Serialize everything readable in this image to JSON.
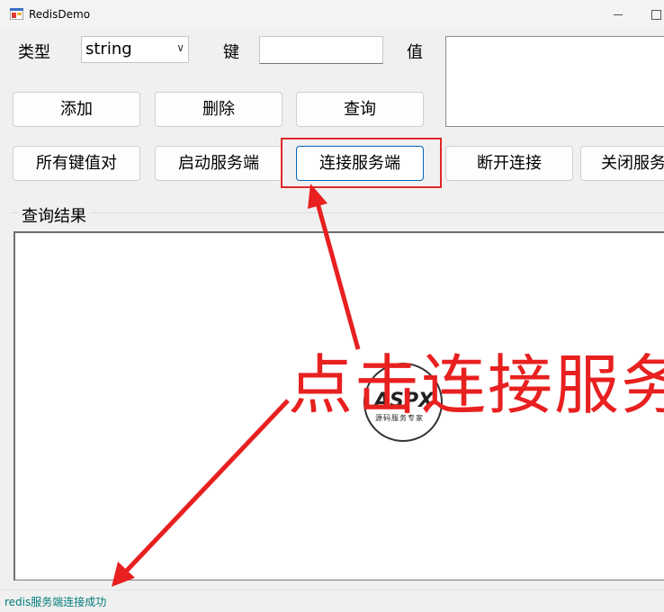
{
  "window": {
    "title": "RedisDemo"
  },
  "form": {
    "type_label": "类型",
    "type_value": "string",
    "key_label": "键",
    "key_value": "",
    "value_label": "值",
    "value_text": ""
  },
  "buttons": {
    "add": "添加",
    "delete": "删除",
    "query": "查询",
    "all_pairs": "所有键值对",
    "start_server": "启动服务端",
    "connect_server": "连接服务端",
    "disconnect": "断开连接",
    "close_server": "关闭服务"
  },
  "results": {
    "group_title": "查询结果",
    "content": ""
  },
  "status": {
    "text": "redis服务端连接成功"
  },
  "annotation": {
    "text": "点击连接服务",
    "color": "#e82020"
  },
  "watermark": {
    "logo": "ASPX",
    "subtitle": "源码服务专家"
  }
}
